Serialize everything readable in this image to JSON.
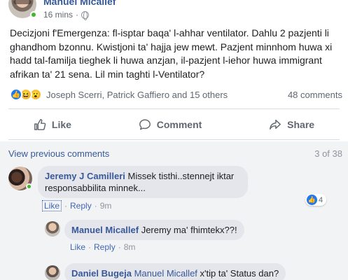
{
  "post": {
    "author": "Manuel Micallef",
    "time": "16 mins",
    "privacy_icon": "globe-icon",
    "text": "Decizjoni f'Emergenza: fl-isptar baqa' l-ahhar ventilator. Dahlu 2 pazjenti li ghandhom bzonnu. Kwistjoni ta' hajja jew mewt. Pazjent minnhom huwa xi hadd tal-familja tieghek li huwa anzjan, il-pazjent l-iehor huwa immigrant afrikan ta' 21 sena. Lil min taghti l-Ventilator?",
    "reactions": {
      "icons": [
        "like-icon",
        "haha-icon",
        "wow-icon"
      ],
      "reactors": "Joseph Scerri, Patrick Gaffiero and 15 others",
      "comments_count": "48 comments"
    }
  },
  "actions": {
    "like": "Like",
    "comment": "Comment",
    "share": "Share"
  },
  "comments_section": {
    "view_previous": "View previous comments",
    "page": "3 of 38",
    "comments": [
      {
        "author": "Jeremy J Camilleri",
        "text": "Missek tisthi..stennejt iktar responsabbilita minnek...",
        "like": "Like",
        "reply": "Reply",
        "time": "9m",
        "reaction_count": "4"
      },
      {
        "author": "Manuel Micallef",
        "text": "Jeremy ma' fhimtekx??!",
        "like": "Like",
        "reply": "Reply",
        "time": "8m"
      },
      {
        "author": "Daniel Bugeja",
        "mention": "Manuel Micallef",
        "text": "x'tip ta' Status dan?"
      }
    ]
  },
  "colors": {
    "link_blue": "#385898",
    "like_blue": "#2078f4",
    "online_green": "#42b72a",
    "comments_bg": "#f2f3f5"
  }
}
